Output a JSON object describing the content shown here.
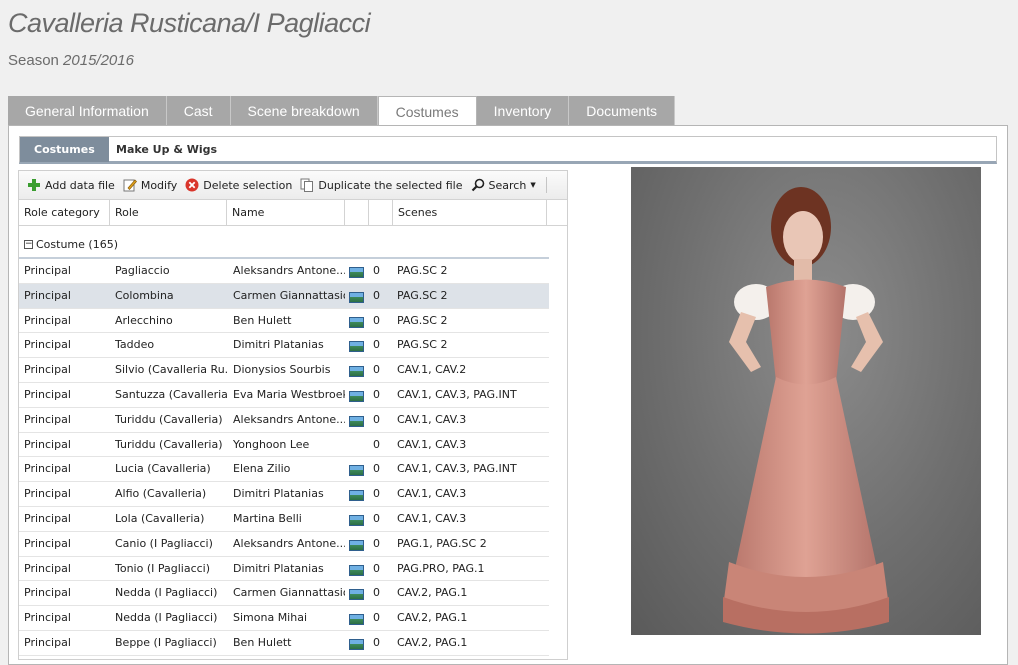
{
  "header": {
    "title": "Cavalleria Rusticana/I Pagliacci",
    "season_label": "Season",
    "season_years": "2015/2016"
  },
  "tabs": [
    {
      "label": "General Information",
      "active": false
    },
    {
      "label": "Cast",
      "active": false
    },
    {
      "label": "Scene breakdown",
      "active": false
    },
    {
      "label": "Costumes",
      "active": true
    },
    {
      "label": "Inventory",
      "active": false
    },
    {
      "label": "Documents",
      "active": false
    }
  ],
  "subtabs": [
    {
      "label": "Costumes",
      "active": true
    },
    {
      "label": "Make Up & Wigs",
      "active": false
    }
  ],
  "toolbar": {
    "add": "Add data file",
    "modify": "Modify",
    "delete": "Delete selection",
    "duplicate": "Duplicate the selected file",
    "search": "Search"
  },
  "columns": [
    "Role category",
    "Role",
    "Name",
    "",
    "",
    "Scenes"
  ],
  "group": {
    "label": "Costume (165)",
    "collapse_symbol": "−"
  },
  "rows": [
    {
      "category": "Principal",
      "role": "Pagliaccio",
      "name": "Aleksandrs Antone...",
      "img": true,
      "count": "0",
      "scenes": "PAG.SC 2",
      "selected": false
    },
    {
      "category": "Principal",
      "role": "Colombina",
      "name": "Carmen Giannattasio",
      "img": true,
      "count": "0",
      "scenes": "PAG.SC 2",
      "selected": true
    },
    {
      "category": "Principal",
      "role": "Arlecchino",
      "name": "Ben Hulett",
      "img": true,
      "count": "0",
      "scenes": "PAG.SC 2",
      "selected": false
    },
    {
      "category": "Principal",
      "role": "Taddeo",
      "name": "Dimitri Platanias",
      "img": true,
      "count": "0",
      "scenes": "PAG.SC 2",
      "selected": false
    },
    {
      "category": "Principal",
      "role": "Silvio (Cavalleria Ru...",
      "name": "Dionysios Sourbis",
      "img": true,
      "count": "0",
      "scenes": "CAV.1, CAV.2",
      "selected": false
    },
    {
      "category": "Principal",
      "role": "Santuzza (Cavalleria)",
      "name": "Eva Maria Westbroek",
      "img": true,
      "count": "0",
      "scenes": "CAV.1, CAV.3, PAG.INT",
      "selected": false
    },
    {
      "category": "Principal",
      "role": "Turiddu (Cavalleria)",
      "name": "Aleksandrs Antone...",
      "img": true,
      "count": "0",
      "scenes": "CAV.1, CAV.3",
      "selected": false
    },
    {
      "category": "Principal",
      "role": "Turiddu (Cavalleria)",
      "name": "Yonghoon Lee",
      "img": false,
      "count": "0",
      "scenes": "CAV.1, CAV.3",
      "selected": false
    },
    {
      "category": "Principal",
      "role": "Lucia (Cavalleria)",
      "name": "Elena Zilio",
      "img": true,
      "count": "0",
      "scenes": "CAV.1, CAV.3, PAG.INT",
      "selected": false
    },
    {
      "category": "Principal",
      "role": "Alfio (Cavalleria)",
      "name": "Dimitri Platanias",
      "img": true,
      "count": "0",
      "scenes": "CAV.1, CAV.3",
      "selected": false
    },
    {
      "category": "Principal",
      "role": "Lola (Cavalleria)",
      "name": "Martina Belli",
      "img": true,
      "count": "0",
      "scenes": "CAV.1, CAV.3",
      "selected": false
    },
    {
      "category": "Principal",
      "role": "Canio (I Pagliacci)",
      "name": "Aleksandrs Antone...",
      "img": true,
      "count": "0",
      "scenes": "PAG.1, PAG.SC 2",
      "selected": false
    },
    {
      "category": "Principal",
      "role": "Tonio (I Pagliacci)",
      "name": "Dimitri Platanias",
      "img": true,
      "count": "0",
      "scenes": "PAG.PRO, PAG.1",
      "selected": false
    },
    {
      "category": "Principal",
      "role": "Nedda (I Pagliacci)",
      "name": "Carmen Giannattasio",
      "img": true,
      "count": "0",
      "scenes": "CAV.2, PAG.1",
      "selected": false
    },
    {
      "category": "Principal",
      "role": "Nedda (I Pagliacci)",
      "name": "Simona Mihai",
      "img": true,
      "count": "0",
      "scenes": "CAV.2, PAG.1",
      "selected": false
    },
    {
      "category": "Principal",
      "role": "Beppe (I Pagliacci)",
      "name": "Ben Hulett",
      "img": true,
      "count": "0",
      "scenes": "CAV.2, PAG.1",
      "selected": false
    }
  ],
  "colors": {
    "tab_inactive": "#a7a7a7",
    "subtab_active": "#7e8d9c",
    "row_selected": "#dde2e8",
    "dress": "#d8978a"
  }
}
